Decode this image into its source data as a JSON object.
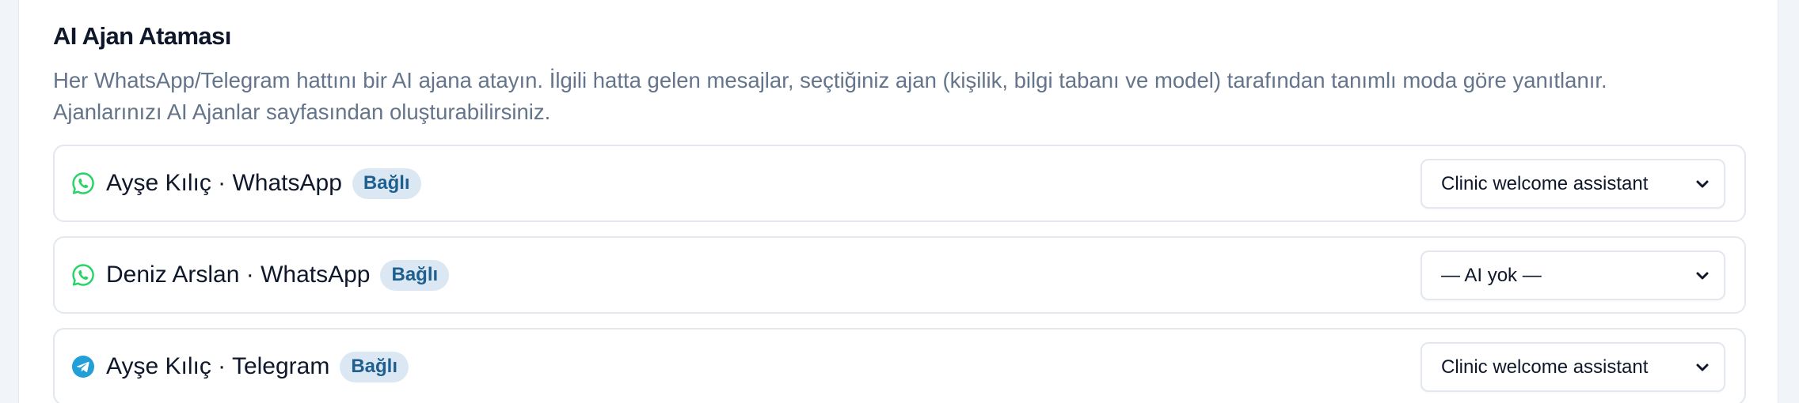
{
  "section": {
    "title": "AI Ajan Ataması",
    "description_line1": "Her WhatsApp/Telegram hattını bir AI ajana atayın. İlgili hatta gelen mesajlar, seçtiğiniz ajan (kişilik, bilgi tabanı ve model) tarafından tanımlı moda göre yanıtlanır.",
    "description_line2": "Ajanlarınızı AI Ajanlar sayfasından oluşturabilirsiniz."
  },
  "rows": [
    {
      "icon": "whatsapp-icon",
      "name": "Ayşe Kılıç · WhatsApp",
      "badge": "Bağlı",
      "selected_agent": "Clinic welcome assistant"
    },
    {
      "icon": "whatsapp-icon",
      "name": "Deniz Arslan · WhatsApp",
      "badge": "Bağlı",
      "selected_agent": "— AI yok —"
    },
    {
      "icon": "telegram-icon",
      "name": "Ayşe Kılıç · Telegram",
      "badge": "Bağlı",
      "selected_agent": "Clinic welcome assistant"
    }
  ],
  "colors": {
    "whatsapp": "#25d366",
    "telegram": "#229ed9",
    "badge_bg": "#dbe7f3",
    "badge_text": "#1f5f8f"
  }
}
